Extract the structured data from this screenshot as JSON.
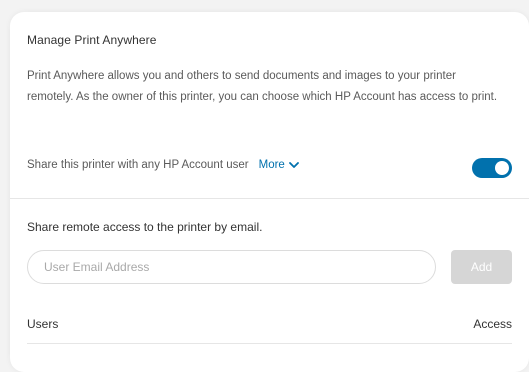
{
  "card": {
    "title": "Manage Print Anywhere",
    "description": "Print Anywhere allows you and others to send documents and images to your printer remotely. As the owner of this printer, you can choose which HP Account has access to print.",
    "share": {
      "label": "Share this printer with any HP Account user",
      "more_label": "More",
      "more_icon": "chevron-down-icon",
      "toggle_on": true
    }
  },
  "email_section": {
    "heading": "Share remote access to the printer by email.",
    "input_placeholder": "User Email Address",
    "input_value": "",
    "add_label": "Add"
  },
  "table": {
    "columns": [
      "Users",
      "Access"
    ]
  },
  "colors": {
    "accent": "#0171ad",
    "button_disabled": "#d6d6d6",
    "card_bg": "#ffffff",
    "page_bg": "#f3f3f3"
  }
}
